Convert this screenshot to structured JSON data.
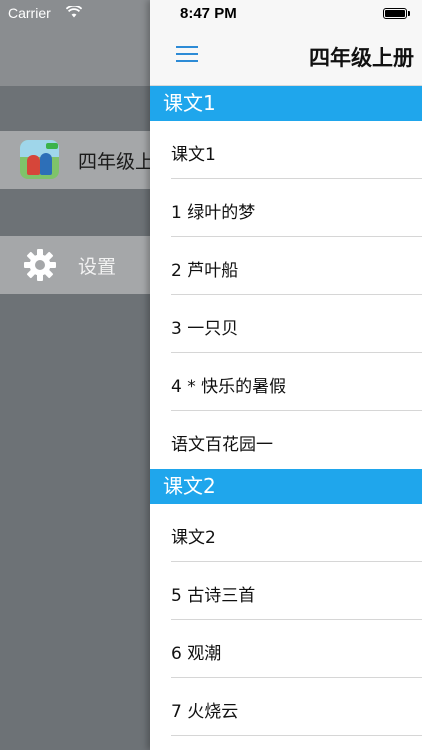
{
  "status_bar": {
    "carrier": "Carrier",
    "time": "8:47 PM"
  },
  "drawer": {
    "items": [
      {
        "label": "四年级上册",
        "icon": "book-cover-thumbnail"
      },
      {
        "label": "设置",
        "icon": "gear-icon"
      }
    ]
  },
  "nav": {
    "title": "四年级上册",
    "menu_icon": "hamburger-menu-icon"
  },
  "sections": [
    {
      "title": "课文1",
      "items": [
        "课文1",
        "1 绿叶的梦",
        "2 芦叶船",
        "3 一只贝",
        "4 * 快乐的暑假",
        "语文百花园一"
      ]
    },
    {
      "title": "课文2",
      "items": [
        "课文2",
        "5 古诗三首",
        "6 观潮",
        "7 火烧云"
      ]
    }
  ],
  "colors": {
    "section_header": "#1fa6ec",
    "menu_icon": "#2d8bd6",
    "drawer_bg": "#6d7276"
  }
}
